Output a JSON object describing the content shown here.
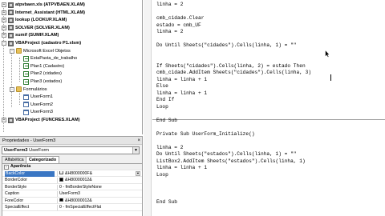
{
  "project_tree": [
    {
      "label": "atpvbaen.xls (ATPVBAEN.XLAM)",
      "icon": "vba-project-icon",
      "expander": "+",
      "bold": true,
      "level": 0
    },
    {
      "label": "Internet_Assistant (HTML.XLAM)",
      "icon": "vba-project-icon",
      "expander": "+",
      "bold": true,
      "level": 0
    },
    {
      "label": "lookup (LOOKUP.XLAM)",
      "icon": "vba-project-icon",
      "expander": "+",
      "bold": true,
      "level": 0
    },
    {
      "label": "SOLVER (SOLVER.XLAM)",
      "icon": "vba-project-icon",
      "expander": "+",
      "bold": true,
      "level": 0
    },
    {
      "label": "sumif (SUMIF.XLAM)",
      "icon": "vba-project-icon",
      "expander": "+",
      "bold": true,
      "level": 0
    },
    {
      "label": "VBAProject (cadastro P1.xlsm)",
      "icon": "vba-project-icon",
      "expander": "-",
      "bold": true,
      "level": 0
    },
    {
      "label": "Microsoft Excel Objetos",
      "icon": "folder-icon",
      "expander": "-",
      "bold": false,
      "level": 1
    },
    {
      "label": "EstaPasta_de_trabalho",
      "icon": "workbook-icon",
      "expander": "",
      "bold": false,
      "level": 2
    },
    {
      "label": "Plan1 (Cadastro)",
      "icon": "sheet-icon",
      "expander": "",
      "bold": false,
      "level": 2
    },
    {
      "label": "Plan2 (cidades)",
      "icon": "sheet-icon",
      "expander": "",
      "bold": false,
      "level": 2
    },
    {
      "label": "Plan3 (estados)",
      "icon": "sheet-icon",
      "expander": "",
      "bold": false,
      "level": 2
    },
    {
      "label": "Formulários",
      "icon": "folder-icon",
      "expander": "-",
      "bold": false,
      "level": 1
    },
    {
      "label": "UserForm1",
      "icon": "userform-icon",
      "expander": "",
      "bold": false,
      "level": 2
    },
    {
      "label": "UserForm2",
      "icon": "userform-icon",
      "expander": "",
      "bold": false,
      "level": 2
    },
    {
      "label": "UserForm3",
      "icon": "userform-icon",
      "expander": "",
      "bold": false,
      "level": 2
    },
    {
      "label": "VBAProject (FUNCRES.XLAM)",
      "icon": "vba-project-icon",
      "expander": "+",
      "bold": true,
      "level": 0
    }
  ],
  "properties": {
    "title": "Propriedades - UserForm3",
    "close_glyph": "×",
    "object_name": "UserForm3",
    "object_type": "UserForm",
    "tabs": [
      "Alfabética",
      "Categorizado"
    ],
    "active_tab": "Categorizado",
    "category": "Aparência",
    "category_expander": "-",
    "rows": [
      {
        "name": "BackColor",
        "value": "&H8000000F&",
        "swatch": "#f0f0f0",
        "dropdown": true
      },
      {
        "name": "BorderColor",
        "value": "&H80000012&",
        "swatch": "#000000",
        "dropdown": false
      },
      {
        "name": "BorderStyle",
        "value": "0 - fmBorderStyleNone",
        "swatch": "",
        "dropdown": false
      },
      {
        "name": "Caption",
        "value": "UserForm3",
        "swatch": "",
        "dropdown": false
      },
      {
        "name": "ForeColor",
        "value": "&H80000012&",
        "swatch": "#000000",
        "dropdown": false
      },
      {
        "name": "SpecialEffect",
        "value": "0 - fmSpecialEffectFlat",
        "swatch": "",
        "dropdown": false
      }
    ]
  },
  "code_lines": [
    "linha = 2",
    "",
    "cmb_cidade.Clear",
    "estado = cmb_UF",
    "linha = 2",
    "",
    "Do Until Sheets(\"cidades\").Cells(linha, 1) = \"\"",
    "",
    "",
    "If Sheets(\"cidades\").Cells(linha, 2) = estado Then",
    "cmb_cidade.AddItem Sheets(\"cidades\").Cells(linha, 3)",
    "linha = linha + 1",
    "Else",
    "linha = linha + 1",
    "End If",
    "Loop",
    "",
    "End Sub",
    "",
    "Private Sub UserForm_Initialize()",
    "",
    "linha = 2",
    "Do Until Sheets(\"estados\").Cells(linha, 1) = \"\"",
    "ListBox2.AddItem Sheets(\"estados\").Cells(linha, 1)",
    "linha = linha + 1",
    "Loop",
    "",
    "",
    "",
    "End Sub"
  ]
}
